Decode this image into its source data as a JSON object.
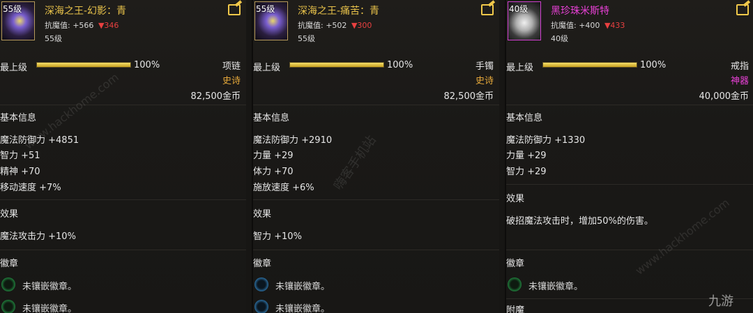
{
  "items": [
    {
      "level_badge": "55级",
      "name": "深海之王-幻影：青",
      "resist_label": "抗魔值:",
      "resist_up": "+566",
      "resist_down": "▼346",
      "level_text": "55级",
      "top_level_label": "最上级",
      "progress": 100,
      "progress_text": "100%",
      "slot": "项链",
      "rarity": "史诗",
      "price": "82,500金币",
      "basic_info_title": "基本信息",
      "stats": [
        "魔法防御力 +4851",
        "智力 +51",
        "精神 +70",
        "移动速度 +7%"
      ],
      "effect_title": "效果",
      "effect_text": "魔法攻击力 +10%",
      "emblem_title": "徽章",
      "emblems": [
        "未镶嵌徽章。",
        "未镶嵌徽章。"
      ]
    },
    {
      "level_badge": "55级",
      "name": "深海之王-痛苦：青",
      "resist_label": "抗魔值:",
      "resist_up": "+502",
      "resist_down": "▼300",
      "level_text": "55级",
      "top_level_label": "最上级",
      "progress": 100,
      "progress_text": "100%",
      "slot": "手镯",
      "rarity": "史诗",
      "price": "82,500金币",
      "basic_info_title": "基本信息",
      "stats": [
        "魔法防御力 +2910",
        "力量 +29",
        "体力 +70",
        "施放速度 +6%"
      ],
      "effect_title": "效果",
      "effect_text": "智力 +10%",
      "emblem_title": "徽章",
      "emblems": [
        "未镶嵌徽章。",
        "未镶嵌徽章。"
      ]
    },
    {
      "level_badge": "40级",
      "name": "黑珍珠米斯特",
      "resist_label": "抗魔值:",
      "resist_up": "+400",
      "resist_down": "▼433",
      "level_text": "40级",
      "top_level_label": "最上级",
      "progress": 100,
      "progress_text": "100%",
      "slot": "戒指",
      "rarity": "神器",
      "price": "40,000金币",
      "basic_info_title": "基本信息",
      "stats": [
        "魔法防御力 +1330",
        "力量 +29",
        "智力 +29"
      ],
      "effect_title": "效果",
      "effect_text": "破招魔法攻击时，增加50%的伤害。",
      "emblem_title": "徽章",
      "emblems": [
        "未镶嵌徽章。"
      ],
      "extra_section": "附魔"
    }
  ],
  "colors": {
    "epic": "#e7a93a",
    "artifact": "#e840d6",
    "name_gold": "#e7c14a",
    "down_red": "#e84040"
  },
  "watermarks": [
    "www.hackhome.com",
    "嗨客手机站",
    "www.hackhome.com",
    "九游"
  ]
}
